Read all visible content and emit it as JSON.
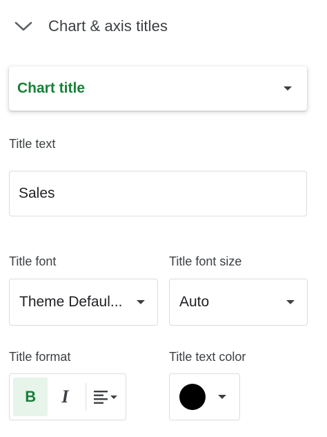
{
  "section": {
    "title": "Chart & axis titles",
    "expanded_icon": "chevron-down-icon"
  },
  "target_select": {
    "value": "Chart title",
    "color": "#188038"
  },
  "title_text": {
    "label": "Title text",
    "value": "Sales"
  },
  "title_font": {
    "label": "Title font",
    "value": "Theme Defaul..."
  },
  "title_font_size": {
    "label": "Title font size",
    "value": "Auto"
  },
  "title_format": {
    "label": "Title format",
    "bold_label": "B",
    "bold_active": true,
    "italic_label": "I",
    "align_icon": "align-left-icon"
  },
  "title_text_color": {
    "label": "Title text color",
    "value": "#000000"
  }
}
